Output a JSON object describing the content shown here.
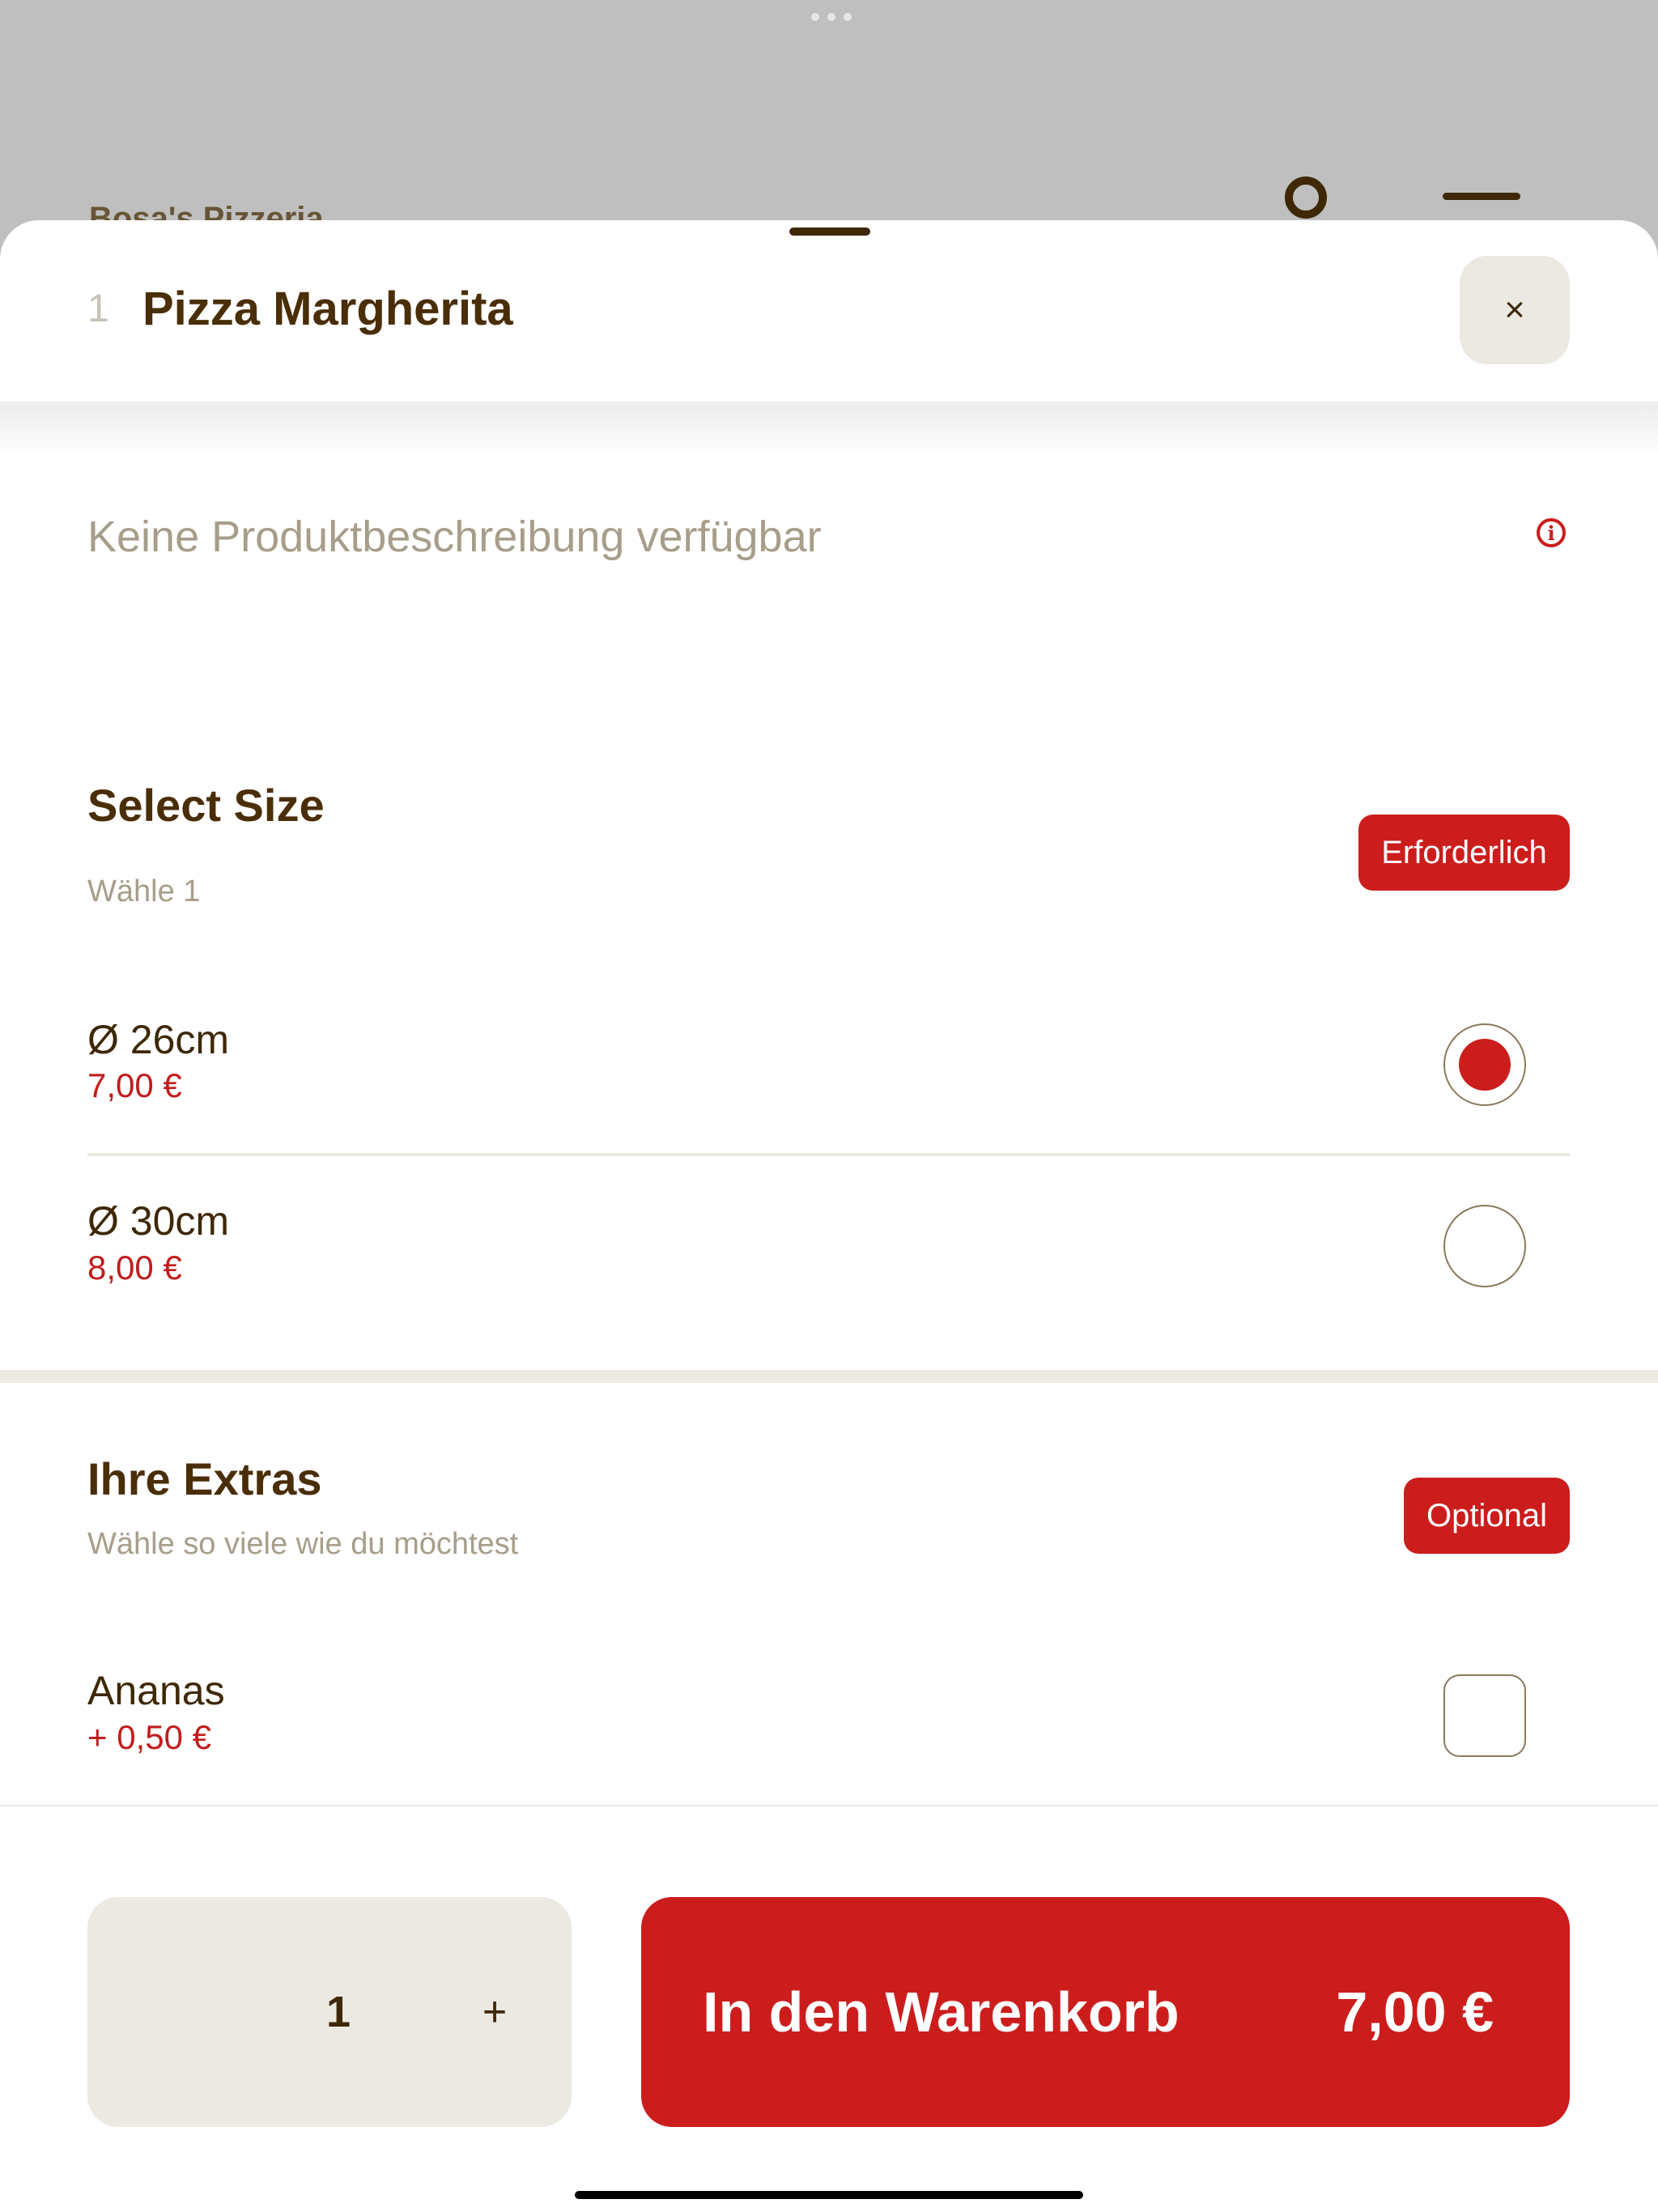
{
  "background": {
    "brand_name": "Bosa's Pizzeria"
  },
  "sheet": {
    "quantity_prefix": "1",
    "title": "Pizza Margherita",
    "close_label": "×",
    "description": "Keine Produktbeschreibung verfügbar",
    "info_icon": "i"
  },
  "size_section": {
    "title": "Select Size",
    "subtitle": "Wähle 1",
    "badge": "Erforderlich",
    "options": [
      {
        "name": "Ø 26cm",
        "price": "7,00 €",
        "selected": true
      },
      {
        "name": "Ø 30cm",
        "price": "8,00 €",
        "selected": false
      }
    ]
  },
  "extras_section": {
    "title": "Ihre Extras",
    "subtitle": "Wähle so viele wie du möchtest",
    "badge": "Optional",
    "options": [
      {
        "name": "Ananas",
        "price": "+ 0,50 €",
        "checked": false
      }
    ]
  },
  "footer": {
    "quantity": "1",
    "plus_label": "+",
    "cart_label": "In den Warenkorb",
    "cart_price": "7,00 €"
  },
  "colors": {
    "accent": "#cc1d1d",
    "text_primary": "#4a2e08",
    "text_muted": "#a79e8a",
    "surface": "#ece9e3"
  }
}
